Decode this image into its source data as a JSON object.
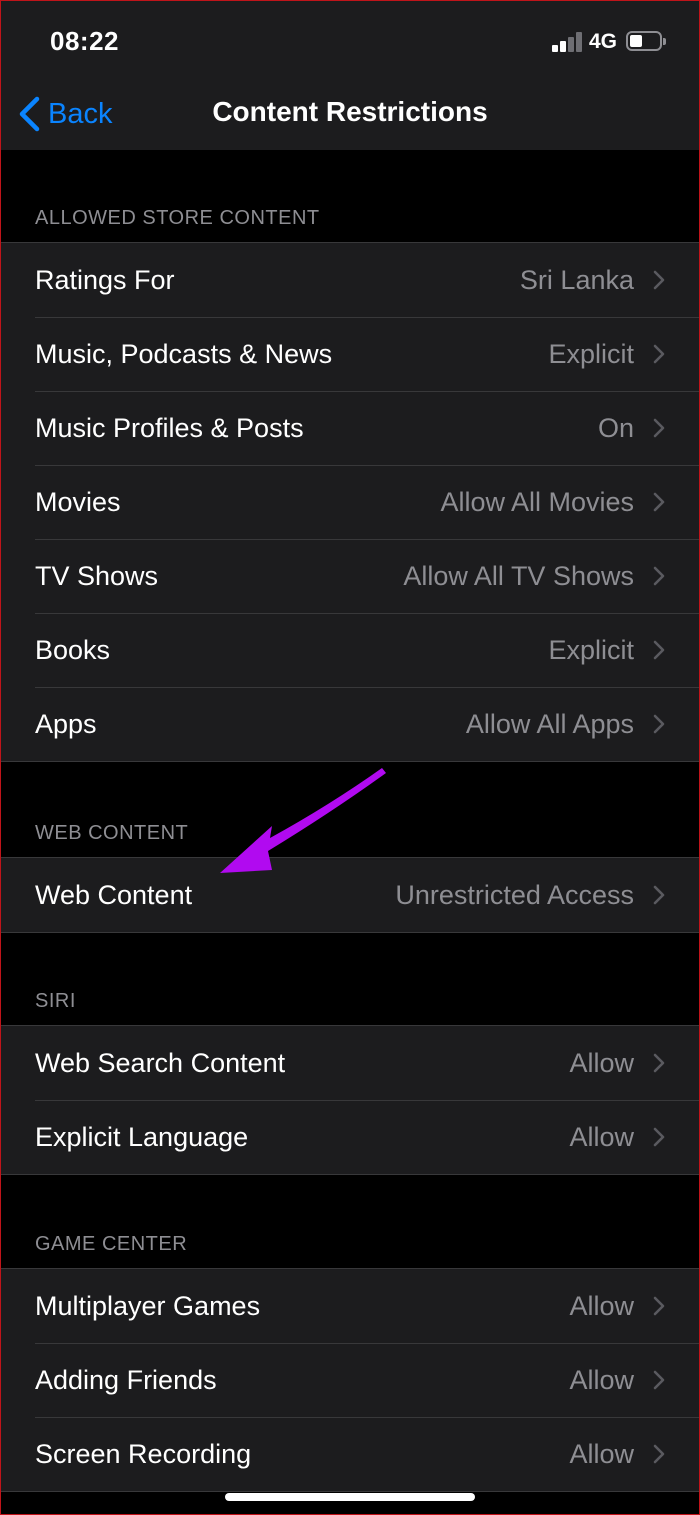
{
  "status_bar": {
    "time": "08:22",
    "network": "4G"
  },
  "nav": {
    "back_label": "Back",
    "title": "Content Restrictions"
  },
  "sections": [
    {
      "header": "ALLOWED STORE CONTENT",
      "rows": [
        {
          "label": "Ratings For",
          "value": "Sri Lanka"
        },
        {
          "label": "Music, Podcasts & News",
          "value": "Explicit"
        },
        {
          "label": "Music Profiles & Posts",
          "value": "On"
        },
        {
          "label": "Movies",
          "value": "Allow All Movies"
        },
        {
          "label": "TV Shows",
          "value": "Allow All TV Shows"
        },
        {
          "label": "Books",
          "value": "Explicit"
        },
        {
          "label": "Apps",
          "value": "Allow All Apps"
        }
      ]
    },
    {
      "header": "WEB CONTENT",
      "rows": [
        {
          "label": "Web Content",
          "value": "Unrestricted Access"
        }
      ]
    },
    {
      "header": "SIRI",
      "rows": [
        {
          "label": "Web Search Content",
          "value": "Allow"
        },
        {
          "label": "Explicit Language",
          "value": "Allow"
        }
      ]
    },
    {
      "header": "GAME CENTER",
      "rows": [
        {
          "label": "Multiplayer Games",
          "value": "Allow"
        },
        {
          "label": "Adding Friends",
          "value": "Allow"
        },
        {
          "label": "Screen Recording",
          "value": "Allow"
        }
      ]
    }
  ],
  "colors": {
    "accent": "#0a84ff",
    "annotation_arrow": "#b10af0",
    "background": "#000000",
    "cell": "#1c1c1e",
    "secondary_text": "#8e8e93"
  },
  "icons": {
    "back": "chevron-left-icon",
    "row": "chevron-right-icon",
    "signal": "cellular-signal-icon",
    "battery": "battery-icon",
    "annotation": "arrow-annotation-icon"
  }
}
